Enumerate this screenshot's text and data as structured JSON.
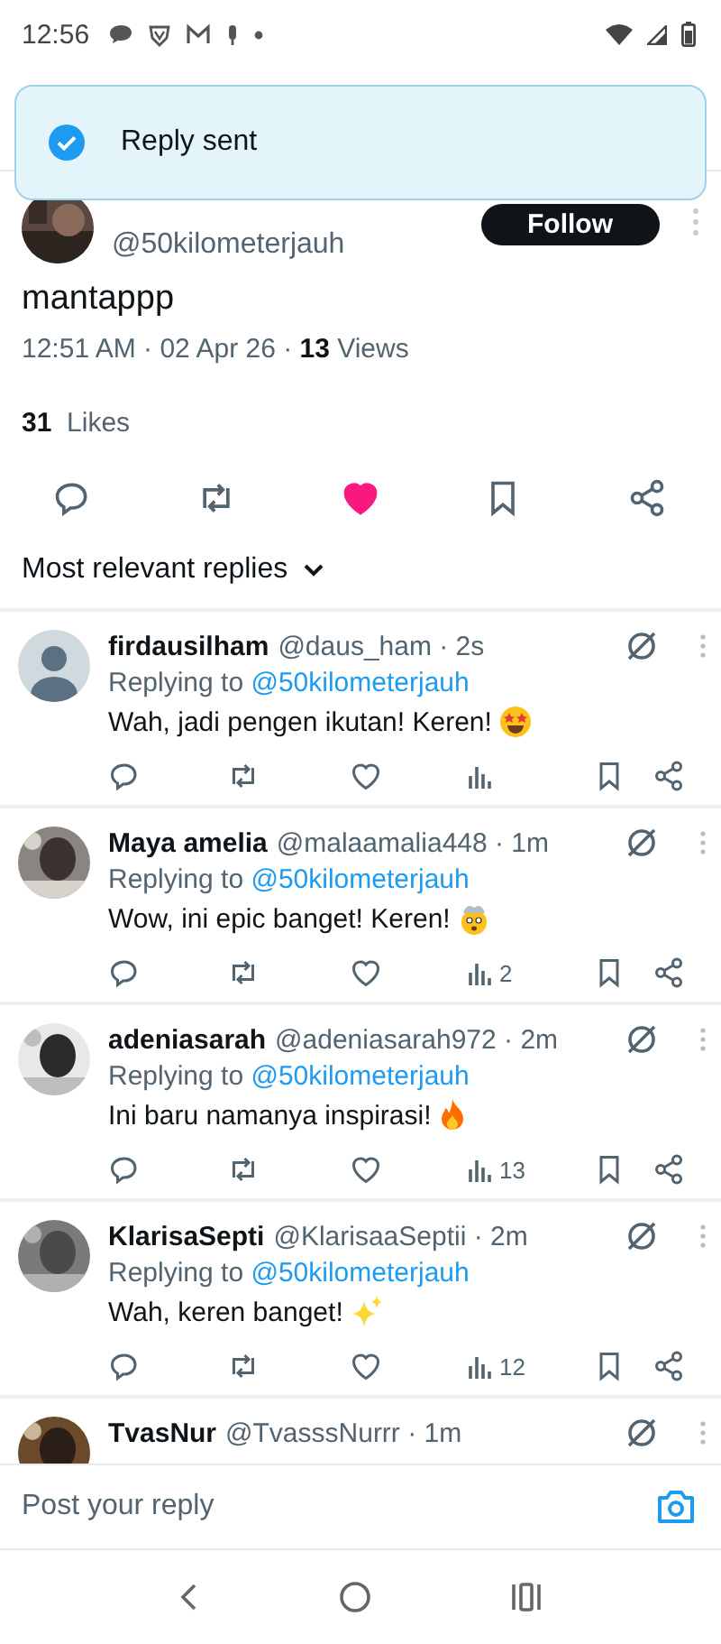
{
  "status_bar": {
    "time": "12:56"
  },
  "toast": {
    "text": "Reply sent"
  },
  "post": {
    "handle": "@50kilometerjauh",
    "follow_label": "Follow",
    "text": "mantappp",
    "timestamp": "12:51 AM · 02 Apr 26 · ",
    "views_count": "13",
    "views_label": " Views",
    "likes_count": "31",
    "likes_label": "Likes",
    "liked": true,
    "bookmarked": false
  },
  "sort": {
    "label": "Most relevant replies"
  },
  "replies": [
    {
      "name": "firdausilham",
      "handle": "@daus_ham · 2s",
      "avatar": {
        "kind": "default"
      },
      "replying_label": "Replying to ",
      "replying_to": "@50kilometerjauh",
      "text": "Wah, jadi pengen ikutan! Keren! ",
      "emoji": {
        "kind": "star_eyes"
      },
      "liked": false
    },
    {
      "name": "Maya amelia",
      "handle": "@malaamalia448 · 1m",
      "replying_label": "Replying to ",
      "replying_to": "@50kilometerjauh",
      "text": "Wow, ini epic banget! Keren! ",
      "emoji": {
        "kind": "mind_blown"
      },
      "views": "2",
      "liked": false
    },
    {
      "name": "adeniasarah",
      "handle": "@adeniasarah972 · 2m",
      "replying_label": "Replying to ",
      "replying_to": "@50kilometerjauh",
      "text": "Ini baru namanya inspirasi! ",
      "emoji": {
        "kind": "fire"
      },
      "views": "13",
      "liked": false
    },
    {
      "name": "KlarisaSepti",
      "handle": "@KlarisaaSeptii · 2m",
      "replying_label": "Replying to ",
      "replying_to": "@50kilometerjauh",
      "text": "Wah, keren banget! ",
      "emoji": {
        "kind": "sparkles"
      },
      "views": "12",
      "liked": false
    },
    {
      "name": "TvasNur",
      "handle": "@TvasssNurrr · 1m"
    }
  ],
  "composer": {
    "placeholder": "Post your reply"
  }
}
